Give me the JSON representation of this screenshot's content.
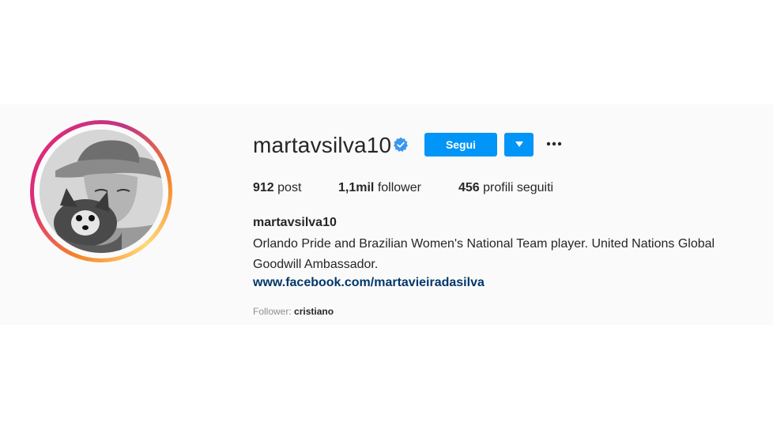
{
  "profile": {
    "username": "martavsilva10",
    "full_name": "martavsilva10",
    "verified": true,
    "bio": "Orlando Pride and Brazilian Women's National Team player. United Nations Global Goodwill Ambassador.",
    "website": "www.facebook.com/martavieiradasilva"
  },
  "actions": {
    "follow_label": "Segui",
    "dropdown_icon": "caret-down-icon",
    "more_icon": "more-options-icon"
  },
  "stats": {
    "posts_count": "912",
    "posts_label": "post",
    "followers_count": "1,1mil",
    "followers_label": "follower",
    "following_count": "456",
    "following_label": "profili seguiti"
  },
  "followed_by": {
    "label": "Follower:",
    "users": "cristiano"
  },
  "colors": {
    "accent": "#0095f6",
    "link": "#00376b",
    "background": "#fafafa",
    "verified": "#3897f0"
  }
}
